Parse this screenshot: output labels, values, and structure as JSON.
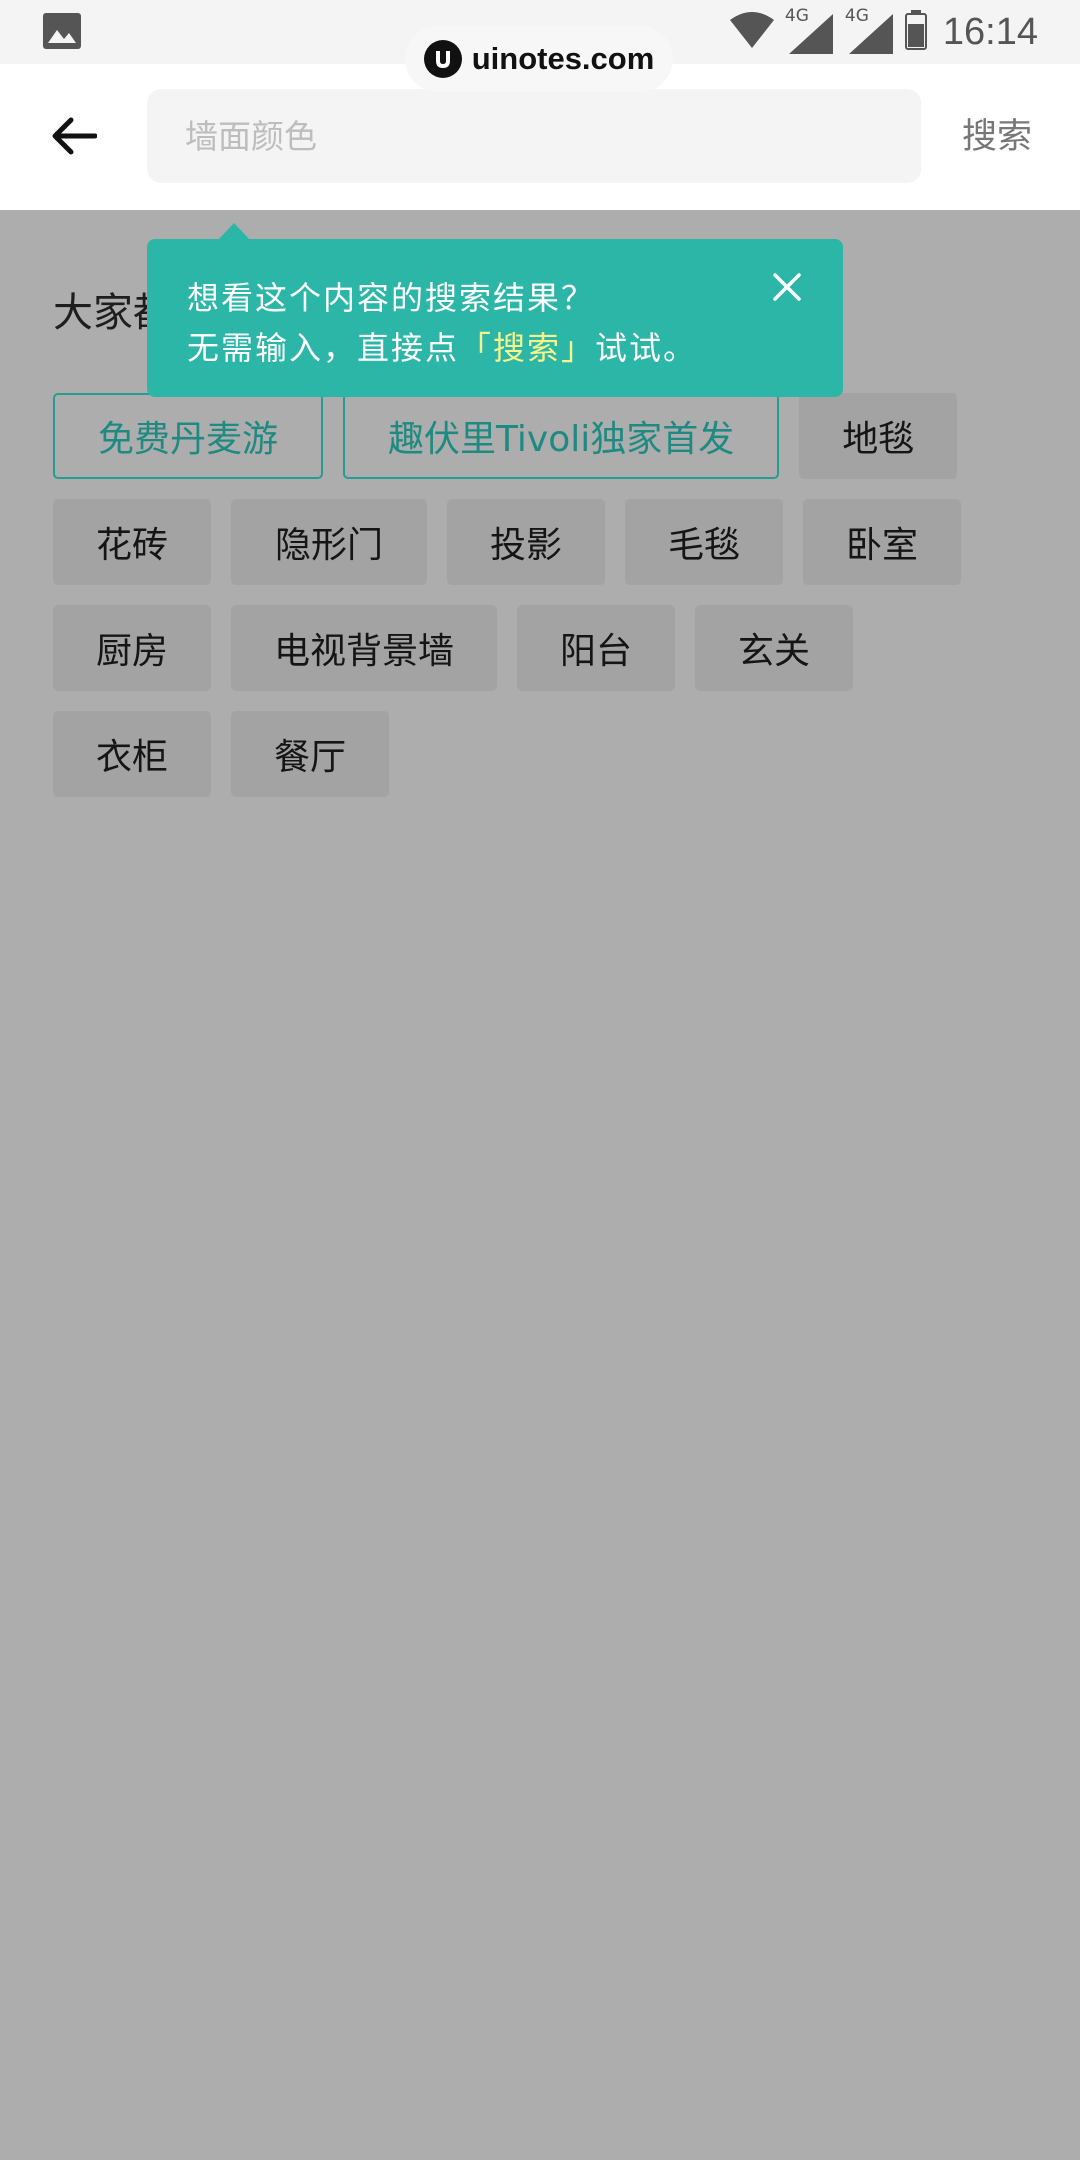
{
  "status_bar": {
    "network_1": "4G",
    "network_2": "4G",
    "time": "16:14",
    "icons": [
      "image-icon",
      "wifi-icon",
      "signal-icon",
      "signal-icon",
      "battery-icon"
    ]
  },
  "watermark": {
    "text": "uinotes.com",
    "logo_icon": "uinotes-logo-icon"
  },
  "header": {
    "back_icon": "arrow-left-icon",
    "search_placeholder": "墙面颜色",
    "search_value": "",
    "search_button": "搜索"
  },
  "section": {
    "title": "大家都在搜"
  },
  "tags": {
    "rows": [
      [
        {
          "label": "免费丹麦游",
          "highlighted": true
        },
        {
          "label": "趣伏里Tivoli独家首发",
          "highlighted": true
        },
        {
          "label": "地毯",
          "highlighted": false
        }
      ],
      [
        {
          "label": "花砖",
          "highlighted": false
        },
        {
          "label": "隐形门",
          "highlighted": false
        },
        {
          "label": "投影",
          "highlighted": false
        },
        {
          "label": "毛毯",
          "highlighted": false
        },
        {
          "label": "卧室",
          "highlighted": false
        }
      ],
      [
        {
          "label": "厨房",
          "highlighted": false
        },
        {
          "label": "电视背景墙",
          "highlighted": false
        },
        {
          "label": "阳台",
          "highlighted": false
        },
        {
          "label": "玄关",
          "highlighted": false
        }
      ],
      [
        {
          "label": "衣柜",
          "highlighted": false
        },
        {
          "label": "餐厅",
          "highlighted": false
        }
      ]
    ]
  },
  "tooltip": {
    "line1": "想看这个内容的搜索结果？",
    "line2_prefix": "无需输入，直接点",
    "line2_highlight": "「搜索」",
    "line2_suffix": "试试。",
    "close_icon": "close-icon"
  },
  "colors": {
    "accent": "#2bb6a8",
    "tag_highlight_border": "#2a9b93",
    "tooltip_highlight": "#f5f48a",
    "overlay_background": "#adadad"
  }
}
